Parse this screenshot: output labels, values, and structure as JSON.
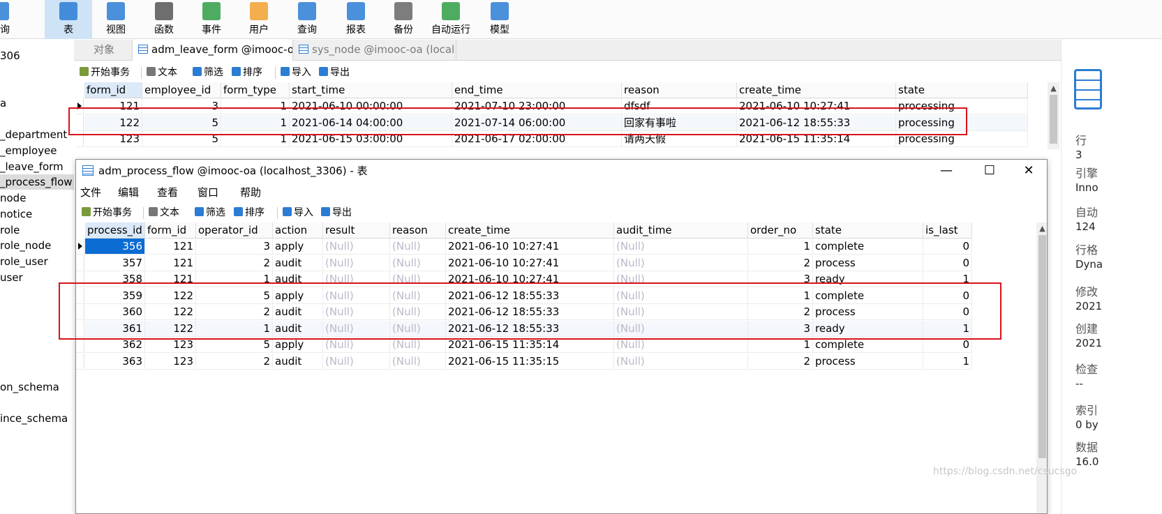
{
  "ribbon": [
    {
      "label": "查询",
      "icon": "query-icon",
      "color": "#2b7cd3"
    },
    {
      "label": "表",
      "icon": "table-icon",
      "color": "#2b7cd3",
      "active": true
    },
    {
      "label": "视图",
      "icon": "view-icon",
      "color": "#2b7cd3"
    },
    {
      "label": "函数",
      "icon": "function-icon",
      "color": "#555555"
    },
    {
      "label": "事件",
      "icon": "event-clock-icon",
      "color": "#2f9e44"
    },
    {
      "label": "用户",
      "icon": "user-icon",
      "color": "#f0a030"
    },
    {
      "label": "查询",
      "icon": "query-grid-icon",
      "color": "#2b7cd3"
    },
    {
      "label": "报表",
      "icon": "report-icon",
      "color": "#2b7cd3"
    },
    {
      "label": "备份",
      "icon": "backup-icon",
      "color": "#666666"
    },
    {
      "label": "自动运行",
      "icon": "automation-icon",
      "color": "#2f9e44"
    },
    {
      "label": "模型",
      "icon": "model-icon",
      "color": "#2b7cd3"
    }
  ],
  "tree": {
    "items": [
      "306",
      "a",
      "_department",
      "_employee",
      "_leave_form",
      "_process_flow",
      "node",
      "notice",
      "role",
      "role_node",
      "role_user",
      "user",
      "on_schema",
      "ince_schema"
    ],
    "selected": "_process_flow"
  },
  "tabs": [
    {
      "label": "对象"
    },
    {
      "label": "adm_leave_form @imooc-o..."
    },
    {
      "label": "sys_node @imooc-oa (local..."
    }
  ],
  "toolbar": {
    "begin_tx": "开始事务",
    "text": "文本",
    "filter": "筛选",
    "sort": "排序",
    "import": "导入",
    "export": "导出"
  },
  "leave_grid": {
    "columns": [
      "form_id",
      "employee_id",
      "form_type",
      "start_time",
      "end_time",
      "reason",
      "create_time",
      "state"
    ],
    "rows": [
      [
        "121",
        "3",
        "1",
        "2021-06-10 00:00:00",
        "2021-07-10 23:00:00",
        "dfsdf",
        "2021-06-10 10:27:41",
        "processing"
      ],
      [
        "122",
        "5",
        "1",
        "2021-06-14 04:00:00",
        "2021-07-14 06:00:00",
        "回家有事啦",
        "2021-06-12 18:55:33",
        "processing"
      ],
      [
        "123",
        "5",
        "1",
        "2021-06-15 03:00:00",
        "2021-06-17 02:00:00",
        "请两天假",
        "2021-06-15 11:35:14",
        "processing"
      ]
    ]
  },
  "window": {
    "title": "adm_process_flow @imooc-oa (localhost_3306) - 表",
    "menu": [
      "文件",
      "编辑",
      "查看",
      "窗口",
      "帮助"
    ],
    "minimize": "—",
    "maximize": "☐",
    "close": "✕"
  },
  "flow_grid": {
    "columns": [
      "process_id",
      "form_id",
      "operator_id",
      "action",
      "result",
      "reason",
      "create_time",
      "audit_time",
      "order_no",
      "state",
      "is_last"
    ],
    "rows": [
      [
        "356",
        "121",
        "3",
        "apply",
        "(Null)",
        "(Null)",
        "2021-06-10 10:27:41",
        "(Null)",
        "1",
        "complete",
        "0"
      ],
      [
        "357",
        "121",
        "2",
        "audit",
        "(Null)",
        "(Null)",
        "2021-06-10 10:27:41",
        "(Null)",
        "2",
        "process",
        "0"
      ],
      [
        "358",
        "121",
        "1",
        "audit",
        "(Null)",
        "(Null)",
        "2021-06-10 10:27:41",
        "(Null)",
        "3",
        "ready",
        "1"
      ],
      [
        "359",
        "122",
        "5",
        "apply",
        "(Null)",
        "(Null)",
        "2021-06-12 18:55:33",
        "(Null)",
        "1",
        "complete",
        "0"
      ],
      [
        "360",
        "122",
        "2",
        "audit",
        "(Null)",
        "(Null)",
        "2021-06-12 18:55:33",
        "(Null)",
        "2",
        "process",
        "0"
      ],
      [
        "361",
        "122",
        "1",
        "audit",
        "(Null)",
        "(Null)",
        "2021-06-12 18:55:33",
        "(Null)",
        "3",
        "ready",
        "1"
      ],
      [
        "362",
        "123",
        "5",
        "apply",
        "(Null)",
        "(Null)",
        "2021-06-15 11:35:14",
        "(Null)",
        "1",
        "complete",
        "0"
      ],
      [
        "363",
        "123",
        "2",
        "audit",
        "(Null)",
        "(Null)",
        "2021-06-15 11:35:15",
        "(Null)",
        "2",
        "process",
        "1"
      ]
    ]
  },
  "info_panel": [
    {
      "label": "行",
      "value": "3"
    },
    {
      "label": "引擎",
      "value": "Inno"
    },
    {
      "label": "自动",
      "value": "124"
    },
    {
      "label": "行格",
      "value": "Dyna"
    },
    {
      "label": "修改",
      "value": "2021"
    },
    {
      "label": "创建",
      "value": "2021"
    },
    {
      "label": "检查",
      "value": "--"
    },
    {
      "label": "索引",
      "value": "0 by"
    },
    {
      "label": "数据",
      "value": "16.0"
    }
  ],
  "watermark": "https://blog.csdn.net/csucsgo",
  "highlight_color": "#d8121b",
  "selection_color": "#0b6cd4"
}
